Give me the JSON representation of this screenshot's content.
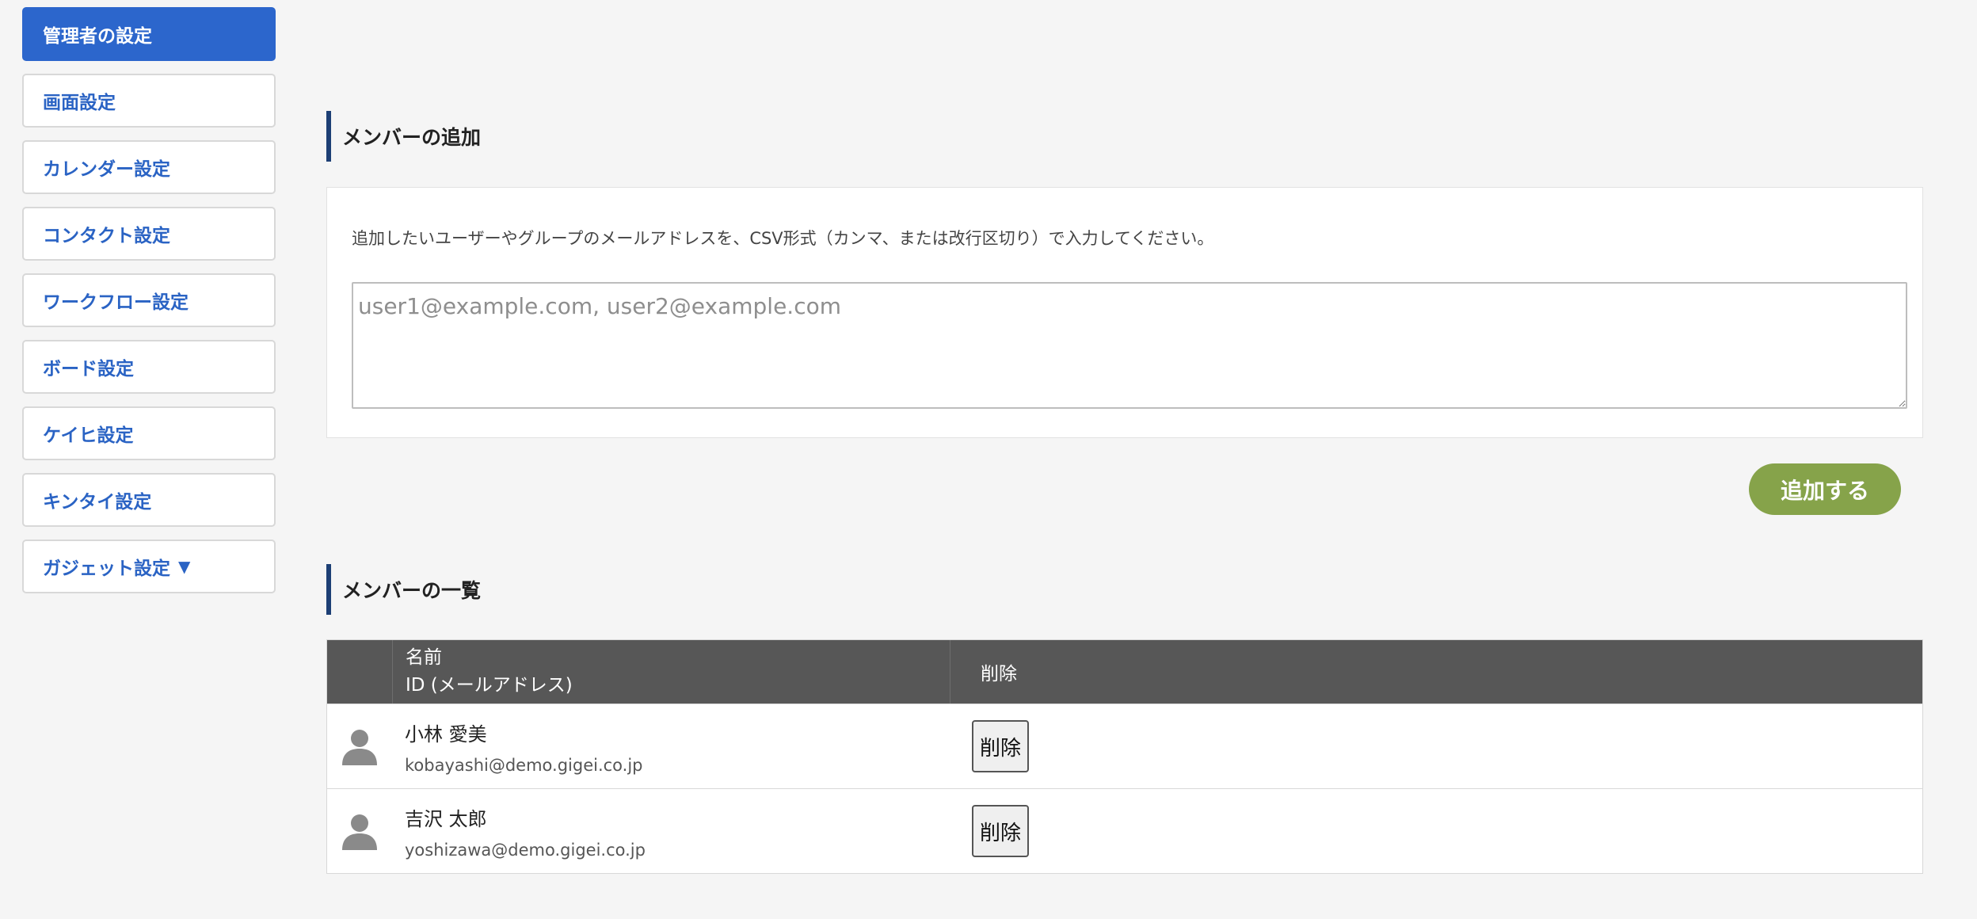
{
  "sidebar": {
    "items": [
      {
        "label": "管理者の設定",
        "active": true
      },
      {
        "label": "画面設定"
      },
      {
        "label": "カレンダー設定"
      },
      {
        "label": "コンタクト設定"
      },
      {
        "label": "ワークフロー設定"
      },
      {
        "label": "ボード設定"
      },
      {
        "label": "ケイヒ設定"
      },
      {
        "label": "キンタイ設定"
      },
      {
        "label": "ガジェット設定",
        "caret": "▼"
      }
    ]
  },
  "add_section": {
    "title": "メンバーの追加",
    "description": "追加したいユーザーやグループのメールアドレスを、CSV形式（カンマ、または改行区切り）で入力してください。",
    "textarea_value": "",
    "textarea_placeholder": "user1@example.com, user2@example.com",
    "add_button": "追加する"
  },
  "list_section": {
    "title": "メンバーの一覧",
    "header": {
      "name": "名前",
      "id": "ID (メールアドレス)",
      "delete": "削除"
    },
    "members": [
      {
        "name": "小林 愛美",
        "email": "kobayashi@demo.gigei.co.jp",
        "delete_label": "削除"
      },
      {
        "name": "吉沢 太郎",
        "email": "yoshizawa@demo.gigei.co.jp",
        "delete_label": "削除"
      }
    ]
  },
  "colors": {
    "accent": "#2c66cc",
    "add_button": "#86a34a",
    "table_header": "#575757",
    "section_bar": "#1d3f75"
  }
}
